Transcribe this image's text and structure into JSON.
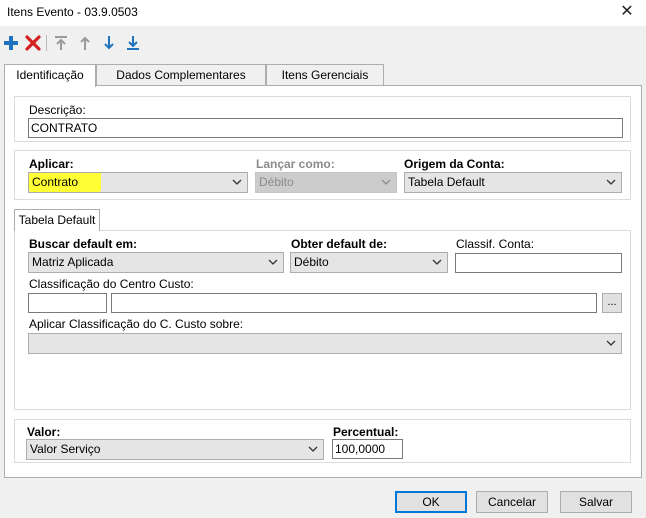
{
  "window": {
    "title": "Itens Evento - 03.9.0503",
    "close_glyph": "✕"
  },
  "toolbar": {
    "buttons": [
      {
        "icon": "plus-icon",
        "color": "#1e73be"
      },
      {
        "icon": "delete-x-icon",
        "color": "#d42020"
      },
      {
        "icon": "move-to-top-icon",
        "color": "#9a9a9a"
      },
      {
        "icon": "arrow-up-icon",
        "color": "#9a9a9a"
      },
      {
        "icon": "arrow-down-icon",
        "color": "#1e73be"
      },
      {
        "icon": "move-to-bottom-icon",
        "color": "#1e73be"
      }
    ]
  },
  "tabs": [
    {
      "label": "Identificação",
      "active": true
    },
    {
      "label": "Dados Complementares",
      "active": false
    },
    {
      "label": "Itens Gerenciais",
      "active": false
    }
  ],
  "descricao": {
    "label": "Descrição:",
    "value": "CONTRATO"
  },
  "aplicar": {
    "label": "Aplicar:",
    "value": "Contrato",
    "highlight_color": "#ffff33"
  },
  "lancar_como": {
    "label": "Lançar como:",
    "value": "Débito",
    "disabled": true
  },
  "origem_conta": {
    "label": "Origem da Conta:",
    "value": "Tabela Default"
  },
  "subtab": {
    "label": "Tabela Default"
  },
  "buscar_default": {
    "label": "Buscar default em:",
    "value": "Matriz Aplicada"
  },
  "obter_default": {
    "label": "Obter default de:",
    "value": "Débito"
  },
  "classif_conta": {
    "label": "Classif. Conta:",
    "value": ""
  },
  "classif_centro_custo": {
    "label": "Classificação do Centro Custo:",
    "code": "",
    "description": "",
    "lookup_label": "..."
  },
  "aplicar_classif": {
    "label": "Aplicar Classificação do C. Custo sobre:",
    "value": ""
  },
  "valor": {
    "label": "Valor:",
    "value": "Valor Serviço"
  },
  "percentual": {
    "label": "Percentual:",
    "value": "100,0000"
  },
  "footer": {
    "ok": "OK",
    "cancel": "Cancelar",
    "save": "Salvar"
  }
}
